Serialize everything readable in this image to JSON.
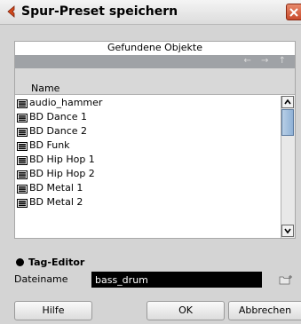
{
  "window": {
    "title": "Spur-Preset speichern"
  },
  "panel": {
    "title": "Gefundene Objekte",
    "nav_arrows": "← → ↑",
    "column_header": "Name",
    "items": [
      "audio_hammer",
      "BD Dance 1",
      "BD Dance 2",
      "BD Funk",
      "BD Hip Hop 1",
      "BD Hip Hop 2",
      "BD Metal 1",
      "BD Metal 2"
    ]
  },
  "tag_editor": {
    "label": "Tag-Editor"
  },
  "file": {
    "label": "Dateiname",
    "value": "bass_drum"
  },
  "buttons": {
    "help": "Hilfe",
    "ok": "OK",
    "cancel": "Abbrechen"
  },
  "colors": {
    "accent": "#d44a1c",
    "nav_strip": "#9fa2a6",
    "input_bg": "#000000"
  }
}
